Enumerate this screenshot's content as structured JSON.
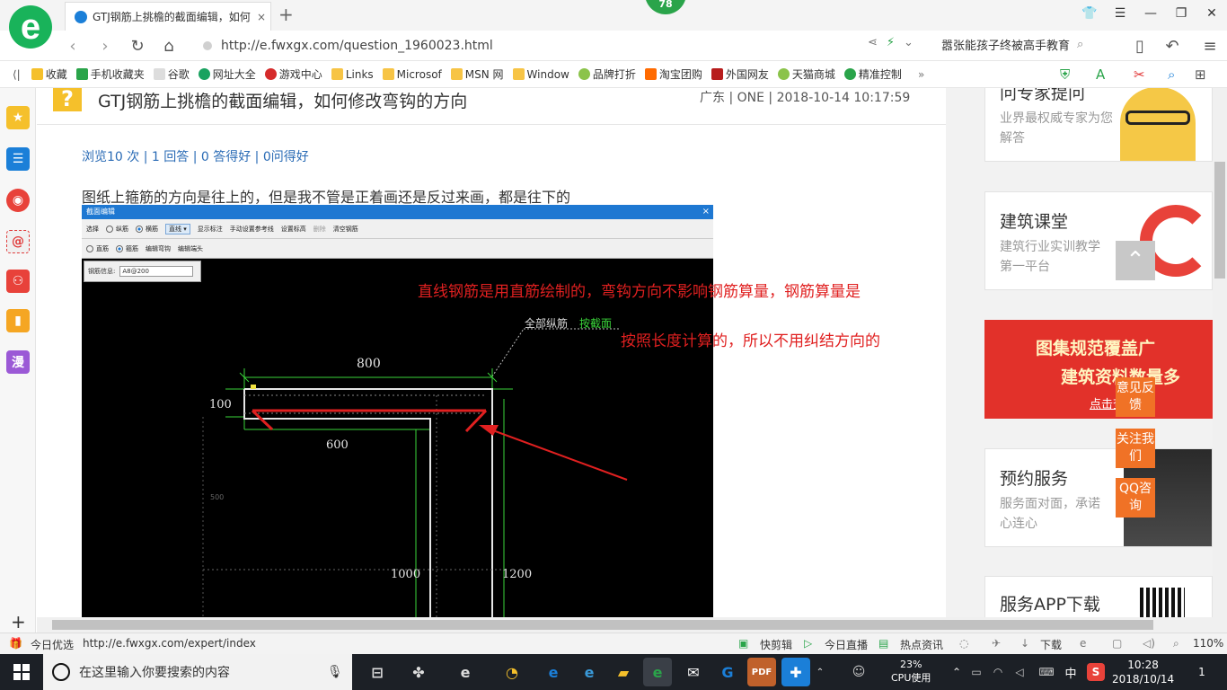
{
  "browser": {
    "tab_title": "GTJ钢筋上挑檐的截面编辑，如何",
    "tab_close": "×",
    "new_tab": "+",
    "badge": "78",
    "url": "http://e.fwxgx.com/question_1960023.html",
    "search_text": "嚣张能孩子终被高手教育"
  },
  "bookmarks": [
    {
      "label": "收藏",
      "icon": "star-icon"
    },
    {
      "label": "手机收藏夹",
      "icon": "phone-icon"
    },
    {
      "label": "谷歌",
      "icon": "page-icon"
    },
    {
      "label": "网址大全",
      "icon": "globe-icon"
    },
    {
      "label": "游戏中心",
      "icon": "game-icon"
    },
    {
      "label": "Links",
      "icon": "folder-icon"
    },
    {
      "label": "Microsof",
      "icon": "folder-icon"
    },
    {
      "label": "MSN 网",
      "icon": "folder-icon"
    },
    {
      "label": "Window",
      "icon": "folder-icon"
    },
    {
      "label": "品牌打折",
      "icon": "leaf-icon"
    },
    {
      "label": "淘宝团购",
      "icon": "taobao-icon"
    },
    {
      "label": "外国网友",
      "icon": "flag-icon"
    },
    {
      "label": "天猫商城",
      "icon": "leaf-icon"
    },
    {
      "label": "精准控制",
      "icon": "chat-icon"
    }
  ],
  "question": {
    "icon_text": "?",
    "title": "GTJ钢筋上挑檐的截面编辑，如何修改弯钩的方向",
    "meta": "广东 | ONE | 2018-10-14 10:17:59",
    "stats": "浏览10 次 | 1 回答 | 0 答得好 | 0问得好",
    "description": "图纸上箍筋的方向是往上的，但是我不管是正着画还是反过来画，都是往下的"
  },
  "screenshot": {
    "window_title": "截面编辑",
    "close": "×",
    "toolbar1": [
      "选择",
      "纵筋",
      "横筋",
      "直线",
      "显示标注",
      "手动设置参考线",
      "设置标高",
      "删除",
      "清空钢筋"
    ],
    "toolbar2": [
      "直筋",
      "箍筋",
      "编辑弯钩",
      "编辑端头"
    ],
    "info_label": "钢筋信息:",
    "info_value": "A8@200",
    "caption": "全部纵筋",
    "caption_link": "按截面",
    "dims": {
      "d800": "800",
      "d100": "100",
      "d600": "600",
      "d1000": "1000",
      "d1200": "1200",
      "d500": "500"
    }
  },
  "annotation": {
    "line1": "直线钢筋是用直筋绘制的，弯钩方向不影响钢筋算量，钢筋算量是",
    "line2": "按照长度计算的，所以不用纠结方向的"
  },
  "sidebar_cards": [
    {
      "title": "问专家提问",
      "sub": "业界最权威专家为您解答"
    },
    {
      "title": "建筑课堂",
      "sub": "建筑行业实训教学第一平台"
    },
    {
      "title": "图集规范覆盖广",
      "sub": "建筑资料数量多",
      "link": "点击查看"
    },
    {
      "title": "预约服务",
      "sub": "服务面对面，承诺心连心"
    },
    {
      "title": "服务APP下载",
      "sub": ""
    }
  ],
  "float_buttons": [
    "意见反馈",
    "关注我们",
    "QQ咨询"
  ],
  "status": {
    "today": "今日优选",
    "link": "http://e.fwxgx.com/expert/index",
    "items": [
      "快剪辑",
      "今日直播",
      "热点资讯",
      "下载"
    ],
    "zoom": "110%"
  },
  "taskbar": {
    "search_placeholder": "在这里输入你要搜索的内容",
    "cpu_pct": "23%",
    "cpu_label": "CPU使用",
    "ime": "中",
    "time": "10:28",
    "date": "2018/10/14",
    "notif": "1"
  }
}
